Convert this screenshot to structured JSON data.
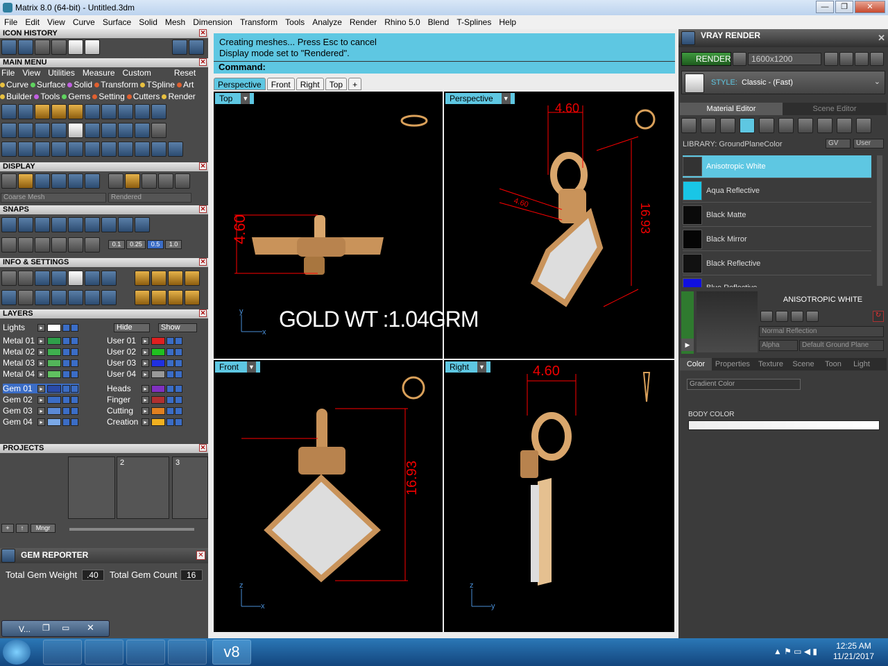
{
  "window": {
    "title": "Matrix 8.0 (64-bit) - Untitled.3dm"
  },
  "menu": [
    "File",
    "Edit",
    "View",
    "Curve",
    "Surface",
    "Solid",
    "Mesh",
    "Dimension",
    "Transform",
    "Tools",
    "Analyze",
    "Render",
    "Rhino 5.0",
    "Blend",
    "T-Splines",
    "Help"
  ],
  "left": {
    "icon_history": "ICON HISTORY",
    "main_menu": "MAIN MENU",
    "main_menu_items": [
      "File",
      "View",
      "Utilities",
      "Measure",
      "Custom"
    ],
    "reset": "Reset",
    "row1": [
      "Curve",
      "Surface",
      "Solid",
      "Transform",
      "TSpline",
      "Art"
    ],
    "row2": [
      "Builder",
      "Tools",
      "Gems",
      "Setting",
      "Cutters",
      "Render"
    ],
    "display": "DISPLAY",
    "display_mesh": "Coarse Mesh",
    "display_mode": "Rendered",
    "snaps": "SNAPS",
    "snap_values": [
      "0.1",
      "0.25",
      "0.5",
      "1.0"
    ],
    "info_settings": "INFO & SETTINGS",
    "layers": "LAYERS",
    "lights": "Lights",
    "hide": "Hide",
    "show": "Show",
    "layer_left": [
      "Metal 01",
      "Metal 02",
      "Metal 03",
      "Metal 04",
      "Gem 01",
      "Gem 02",
      "Gem 03",
      "Gem 04"
    ],
    "layer_right": [
      "User 01",
      "User 02",
      "User 03",
      "User 04",
      "Heads",
      "Finger",
      "Cutting",
      "Creation"
    ],
    "projects": "PROJECTS",
    "project_nums": [
      "2",
      "3"
    ],
    "mngr": "Mngr",
    "gem_reporter": "GEM REPORTER",
    "total_gem_weight_label": "Total Gem Weight",
    "total_gem_weight": ".40",
    "total_gem_count_label": "Total Gem Count",
    "total_gem_count": "16",
    "mini_window": "V..."
  },
  "command": {
    "line1": "Creating meshes... Press Esc to cancel",
    "line2": "Display mode set to \"Rendered\".",
    "prompt": "Command:"
  },
  "viewport_tabs": [
    "Perspective",
    "Front",
    "Right",
    "Top",
    "+"
  ],
  "viewports": {
    "top": "Top",
    "perspective": "Perspective",
    "front": "Front",
    "right": "Right"
  },
  "dims": {
    "top_dim": "4.60",
    "persp_dim1": "4.60",
    "persp_dim2": "16.93",
    "persp_dim3": "4.60",
    "front_dim": "16.93",
    "right_dim": "4.60"
  },
  "gold_wt": "GOLD WT :1.04GRM",
  "right": {
    "title": "VRAY RENDER",
    "render": "RENDER",
    "resolution": "1600x1200",
    "style_label": "STYLE:",
    "style_value": "Classic - (Fast)",
    "material_editor": "Material Editor",
    "scene_editor": "Scene Editor",
    "library": "LIBRARY: GroundPlaneColor",
    "gv": "GV",
    "user": "User",
    "materials": [
      "Anisotropic White",
      "Aqua Reflective",
      "Black Matte",
      "Black Mirror",
      "Black Reflective",
      "Blue Reflective"
    ],
    "material_title": "ANISOTROPIC WHITE",
    "normal_reflection": "Normal Reflection",
    "alpha": "Alpha",
    "default_ground": "Default Ground Plane",
    "subtabs": [
      "Color",
      "Properties",
      "Texture",
      "Scene",
      "Toon",
      "Light"
    ],
    "gradient_color": "Gradient Color",
    "body_color": "BODY COLOR"
  },
  "taskbar": {
    "v8": "v8",
    "time": "12:25 AM",
    "date": "11/21/2017"
  }
}
